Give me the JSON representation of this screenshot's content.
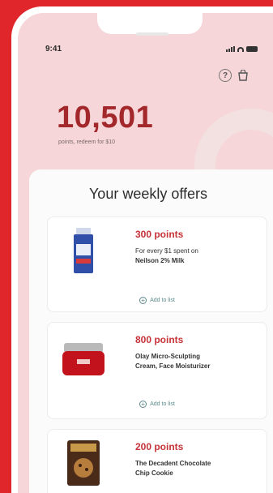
{
  "status_bar": {
    "time": "9:41"
  },
  "header": {
    "points_value": "10,501",
    "points_subtitle": "points, redeem for $10",
    "help_icon": "help-circle-icon",
    "bag_icon": "shopping-bag-icon"
  },
  "offers": {
    "title": "Your weekly offers",
    "add_label": "Add to list",
    "items": [
      {
        "points": "300 points",
        "line1": "For every $1 spent on",
        "line2": "Neilson 2% Milk",
        "image": "milk-carton-icon"
      },
      {
        "points": "800 points",
        "line1": "Olay Micro-Sculpting",
        "line2": "Cream, Face Moisturizer",
        "image": "face-cream-jar-icon"
      },
      {
        "points": "200 points",
        "line1": "The Decadent Chocolate",
        "line2": "Chip Cookie",
        "image": "cookie-box-icon"
      }
    ]
  },
  "colors": {
    "brand": "#e0262b",
    "points": "#a3282c",
    "offer_points": "#c63338",
    "accent_link": "#5d8a8c"
  }
}
